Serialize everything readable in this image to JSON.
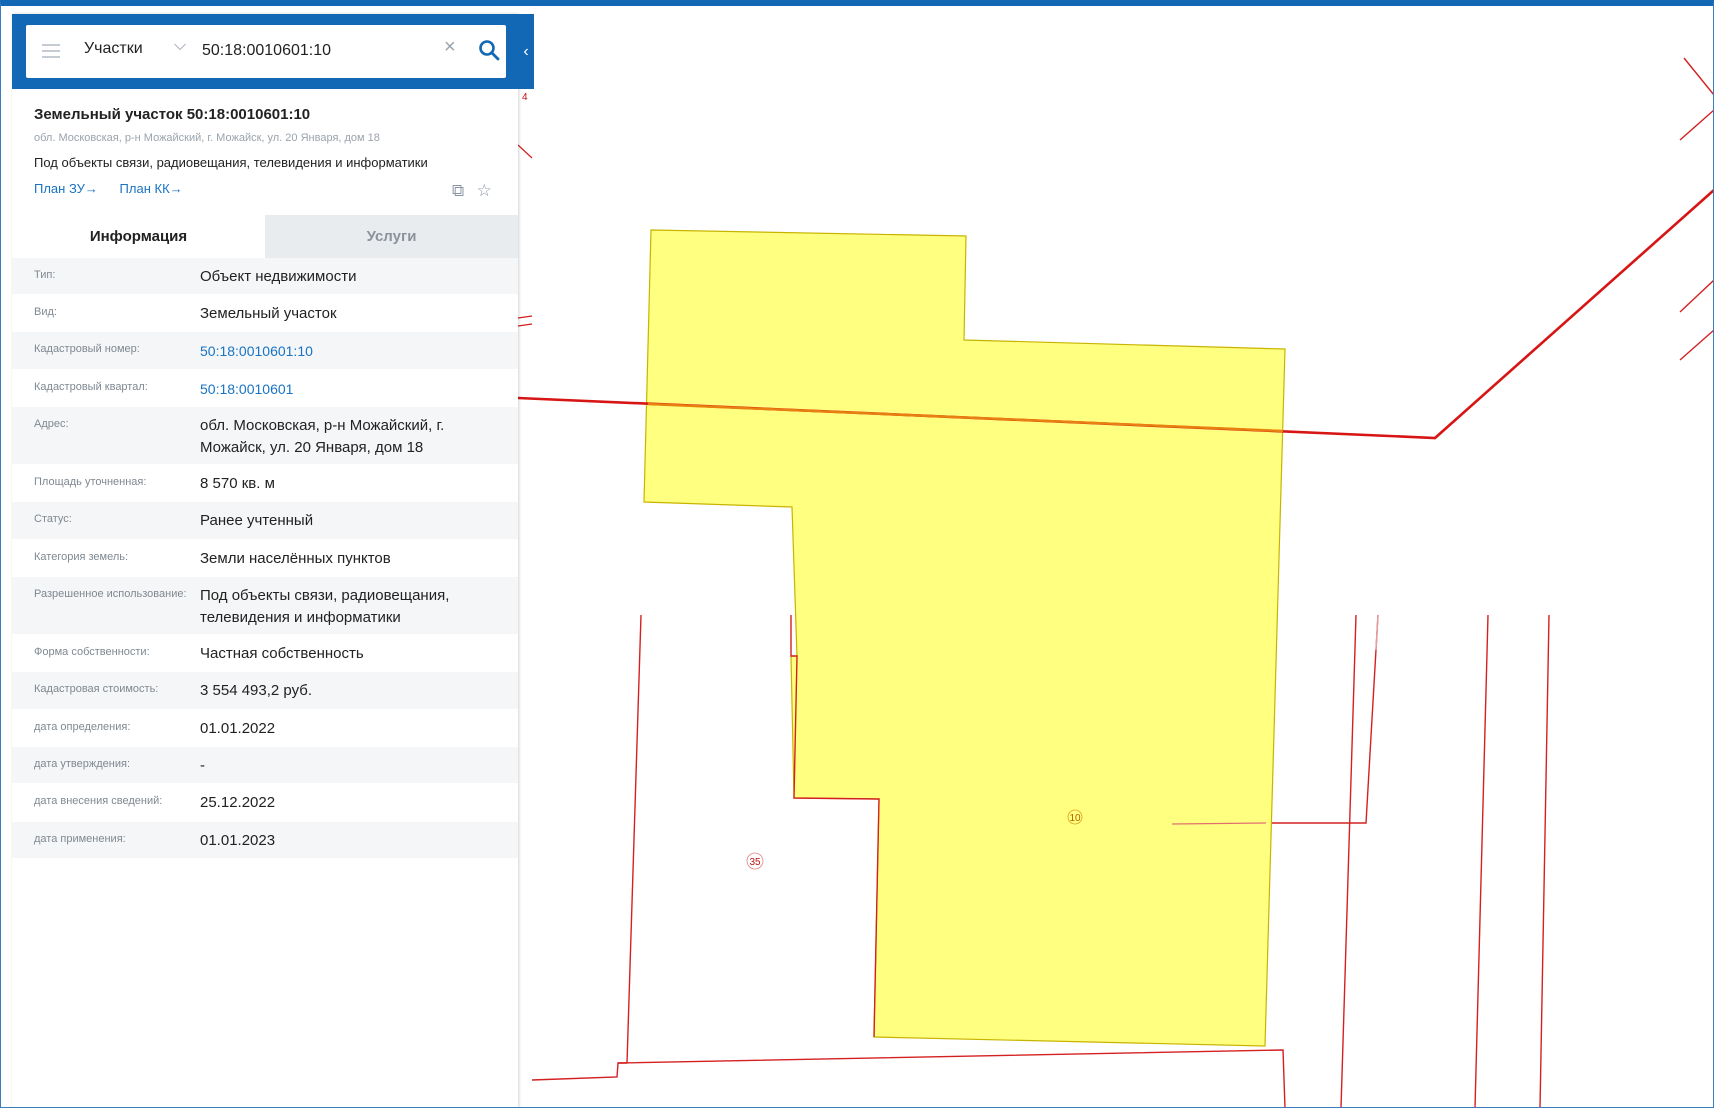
{
  "search": {
    "layer": "Участки",
    "value": "50:18:0010601:10"
  },
  "object": {
    "title": "Земельный участок 50:18:0010601:10",
    "address": "обл. Московская, р-н Можайский, г. Можайск, ул. 20 Января, дом 18",
    "purpose": "Под объекты связи, радиовещания, телевидения и информатики",
    "link_plan_zu": "План ЗУ",
    "link_plan_kk": "План КК"
  },
  "tabs": [
    {
      "label": "Информация"
    },
    {
      "label": "Услуги"
    }
  ],
  "info_rows": [
    {
      "label": "Тип:",
      "value": "Объект недвижимости"
    },
    {
      "label": "Вид:",
      "value": "Земельный участок"
    },
    {
      "label": "Кадастровый номер:",
      "value": "50:18:0010601:10"
    },
    {
      "label": "Кадастровый квартал:",
      "value": "50:18:0010601"
    },
    {
      "label": "Адрес:",
      "value": "обл. Московская, р-н Можайский, г. Можайск, ул. 20 Января, дом 18"
    },
    {
      "label": "Площадь уточненная:",
      "value": "8 570 кв. м"
    },
    {
      "label": "Статус:",
      "value": "Ранее учтенный"
    },
    {
      "label": "Категория земель:",
      "value": "Земли населённых пунктов"
    },
    {
      "label": "Разрешенное использование:",
      "value": "Под объекты связи, радиовещания, телевидения и информатики"
    },
    {
      "label": "Форма собственности:",
      "value": "Частная собственность"
    },
    {
      "label": "Кадастровая стоимость:",
      "value": "3 554 493,2 руб."
    },
    {
      "label": "дата определения:",
      "value": "01.01.2022"
    },
    {
      "label": "дата утверждения:",
      "value": "-"
    },
    {
      "label": "дата внесения сведений:",
      "value": "25.12.2022"
    },
    {
      "label": "дата применения:",
      "value": "01.01.2023"
    }
  ],
  "map": {
    "parcel_label_main": "10",
    "parcel_label_neighbor": "35",
    "parcel_label_edge": "4",
    "highlight_fill": "#ffff80",
    "boundary_color": "#d42020"
  },
  "colors": {
    "accent": "#1368b5",
    "link": "#1873c4"
  }
}
